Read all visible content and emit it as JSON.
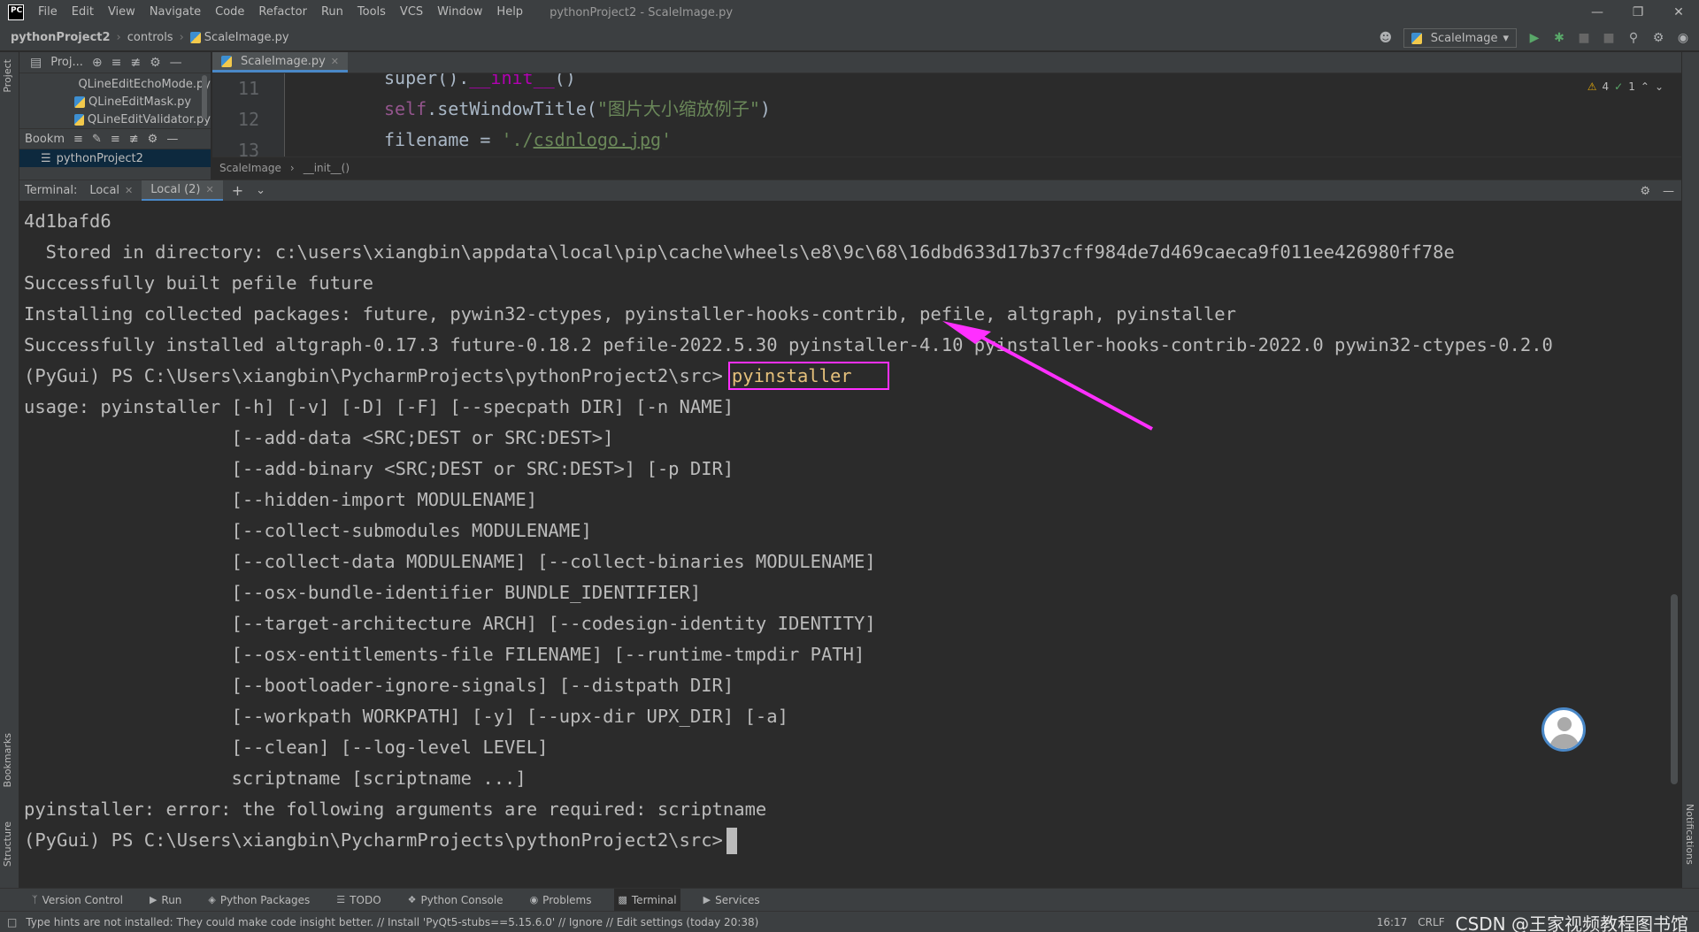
{
  "app": {
    "logo": "PC",
    "window_title": "pythonProject2 - ScaleImage.py",
    "menu": [
      "File",
      "Edit",
      "View",
      "Navigate",
      "Code",
      "Refactor",
      "Run",
      "Tools",
      "VCS",
      "Window",
      "Help"
    ]
  },
  "navbar": {
    "project": "pythonProject2",
    "folder": "controls",
    "file": "ScaleImage.py",
    "run_config": "ScaleImage"
  },
  "project_panel": {
    "title": "Proj...",
    "files": [
      "QLineEditEchoMode.py",
      "QLineEditMask.py",
      "QLineEditValidator.py"
    ],
    "bookmarks_title": "Bookm",
    "bookmark_item": "pythonProject2"
  },
  "left_strip": {
    "project": "Project",
    "bookmarks": "Bookmarks",
    "structure": "Structure"
  },
  "right_strip": {
    "notifications": "Notifications"
  },
  "editor": {
    "tab": "ScaleImage.py",
    "line_numbers": [
      "11",
      "12",
      "13"
    ],
    "code": {
      "l11_a": "super().",
      "l11_b": "__init__",
      "l11_c": "()",
      "l12_a": "self",
      "l12_b": ".setWindowTitle(",
      "l12_c": "\"图片大小缩放例子\"",
      "l12_d": ")",
      "l13_a": "filename = ",
      "l13_b": "'./",
      "l13_c": "csdnlogo.jpg",
      "l13_d": "'"
    },
    "warnings": "4",
    "ok": "1",
    "breadcrumb": [
      "ScaleImage",
      "__init__()"
    ]
  },
  "terminal": {
    "label": "Terminal:",
    "tabs": [
      "Local",
      "Local (2)"
    ],
    "lines": [
      "4d1bafd6",
      "  Stored in directory: c:\\users\\xiangbin\\appdata\\local\\pip\\cache\\wheels\\e8\\9c\\68\\16dbd633d17b37cff984de7d469caeca9f011ee426980ff78e",
      "Successfully built pefile future",
      "Installing collected packages: future, pywin32-ctypes, pyinstaller-hooks-contrib, pefile, altgraph, pyinstaller",
      "Successfully installed altgraph-0.17.3 future-0.18.2 pefile-2022.5.30 pyinstaller-4.10 pyinstaller-hooks-contrib-2022.0 pywin32-ctypes-0.2.0"
    ],
    "prompt": "(PyGui) PS C:\\Users\\xiangbin\\PycharmProjects\\pythonProject2\\src>",
    "command": "pyinstaller",
    "usage_lines": [
      "usage: pyinstaller [-h] [-v] [-D] [-F] [--specpath DIR] [-n NAME]",
      "                   [--add-data <SRC;DEST or SRC:DEST>]",
      "                   [--add-binary <SRC;DEST or SRC:DEST>] [-p DIR]",
      "                   [--hidden-import MODULENAME]",
      "                   [--collect-submodules MODULENAME]",
      "                   [--collect-data MODULENAME] [--collect-binaries MODULENAME]",
      "                   [--osx-bundle-identifier BUNDLE_IDENTIFIER]",
      "                   [--target-architecture ARCH] [--codesign-identity IDENTITY]",
      "                   [--osx-entitlements-file FILENAME] [--runtime-tmpdir PATH]",
      "                   [--bootloader-ignore-signals] [--distpath DIR]",
      "                   [--workpath WORKPATH] [-y] [--upx-dir UPX_DIR] [-a]",
      "                   [--clean] [--log-level LEVEL]",
      "                   scriptname [scriptname ...]",
      "pyinstaller: error: the following arguments are required: scriptname"
    ],
    "final_prompt": "(PyGui) PS C:\\Users\\xiangbin\\PycharmProjects\\pythonProject2\\src>"
  },
  "tool_windows": [
    "Version Control",
    "Run",
    "Python Packages",
    "TODO",
    "Python Console",
    "Problems",
    "Terminal",
    "Services"
  ],
  "status": {
    "message": "Type hints are not installed: They could make code insight better. // Install 'PyQt5-stubs==5.15.6.0' // Ignore // Edit settings (today 20:38)",
    "position": "16:17",
    "line_sep": "CRLF",
    "watermark": "CSDN @王家视频教程图书馆"
  },
  "colors": {
    "highlight_box": "#ff2fff",
    "arrow": "#ff2fff",
    "command_text": "#e5c07b",
    "accent": "#4a88c7"
  }
}
